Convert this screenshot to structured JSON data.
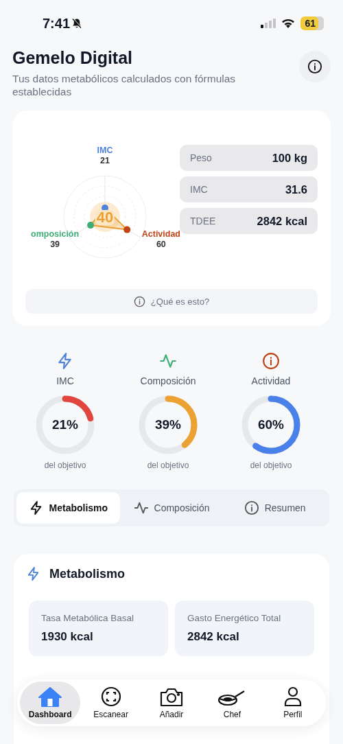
{
  "status_bar": {
    "time": "7:41",
    "battery": "61"
  },
  "header": {
    "title": "Gemelo Digital",
    "subtitle": "Tus datos metabólicos calculados con fórmulas establecidas"
  },
  "twin_card": {
    "radar": {
      "center_value": "40",
      "axes": [
        {
          "label": "IMC",
          "value": "21",
          "color": "#4f82d9"
        },
        {
          "label": "omposición",
          "value": "39",
          "color": "#3fae74"
        },
        {
          "label": "Actividad",
          "value": "60",
          "color": "#c0461a"
        }
      ]
    },
    "stats": [
      {
        "label": "Peso",
        "value": "100 kg"
      },
      {
        "label": "IMC",
        "value": "31.6"
      },
      {
        "label": "TDEE",
        "value": "2842 kcal"
      }
    ],
    "help_button": "¿Qué es esto?"
  },
  "progress": [
    {
      "kind": "bolt",
      "label": "IMC",
      "percent": "21%",
      "level": 0.21,
      "color": "#e0463e",
      "caption": "del objetivo"
    },
    {
      "kind": "pulse",
      "label": "Composición",
      "percent": "39%",
      "level": 0.39,
      "color": "#eca233",
      "caption": "del objetivo"
    },
    {
      "kind": "info",
      "label": "Actividad",
      "percent": "60%",
      "level": 0.6,
      "color": "#4a80ea",
      "caption": "del objetivo"
    }
  ],
  "tabs": [
    {
      "kind": "bolt",
      "label": "Metabolismo",
      "selected": true
    },
    {
      "kind": "pulse",
      "label": "Composición",
      "selected": false
    },
    {
      "kind": "info",
      "label": "Resumen",
      "selected": false
    }
  ],
  "metabolism": {
    "title": "Metabolismo",
    "metrics": [
      {
        "label": "Tasa Metabólica Basal",
        "value": "1930 kcal"
      },
      {
        "label": "Gasto Energético Total",
        "value": "2842 kcal"
      }
    ]
  },
  "nav": [
    {
      "kind": "home",
      "label": "Dashboard",
      "selected": true
    },
    {
      "kind": "scan",
      "label": "Escanear",
      "selected": false
    },
    {
      "kind": "camera",
      "label": "Añadir",
      "selected": false
    },
    {
      "kind": "pan",
      "label": "Chef",
      "selected": false
    },
    {
      "kind": "person",
      "label": "Perfil",
      "selected": false
    }
  ]
}
